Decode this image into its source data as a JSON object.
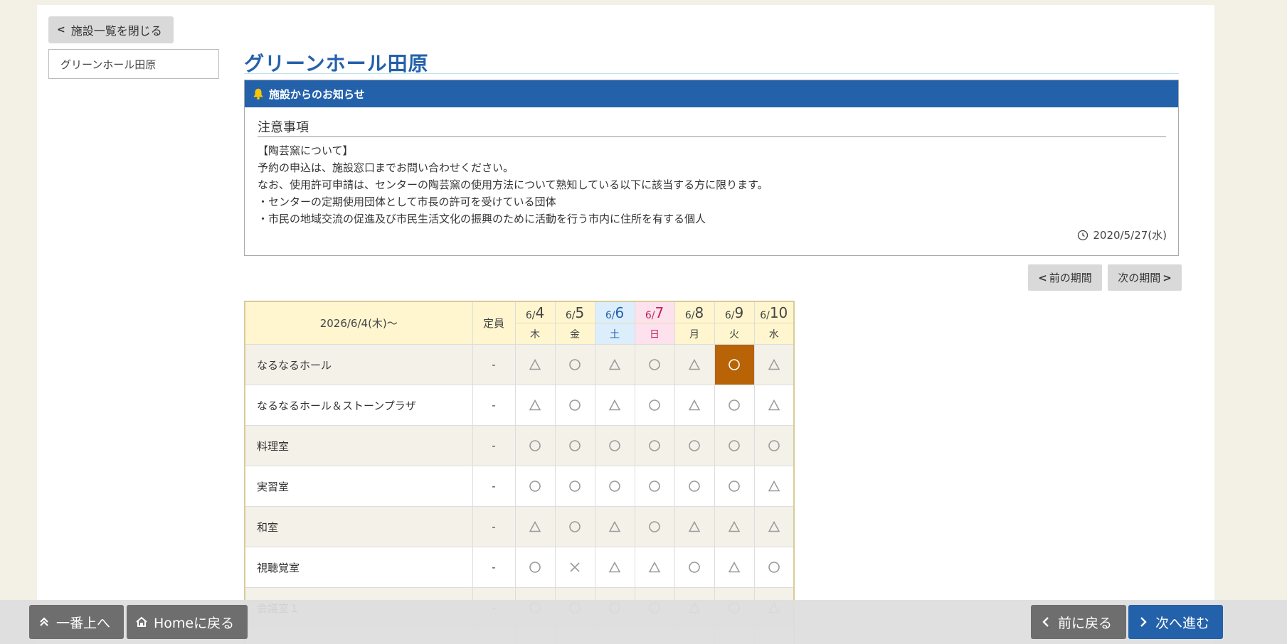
{
  "nav": {
    "close_list": "施設一覧を閉じる",
    "facility_item": "グリーンホール田原"
  },
  "facility": {
    "title": "グリーンホール田原"
  },
  "notice": {
    "header": "施設からのお知らせ",
    "subtitle": "注意事項",
    "lines": [
      "【陶芸窯について】",
      "予約の申込は、施設窓口までお問い合わせください。",
      "なお、使用許可申請は、センターの陶芸窯の使用方法について熟知している以下に該当する方に限ります。",
      "・センターの定期使用団体として市長の許可を受けている団体",
      "・市民の地域交流の促進及び市民生活文化の振興のために活動を行う市内に住所を有する個人"
    ],
    "date": "2020/5/27(水)"
  },
  "period": {
    "prev": "前の期間",
    "next": "次の期間"
  },
  "table": {
    "range_label": "2026/6/4(木)～",
    "capacity_label": "定員",
    "days": [
      {
        "m": "6/",
        "d": "4",
        "w": "木",
        "type": "weekday"
      },
      {
        "m": "6/",
        "d": "5",
        "w": "金",
        "type": "weekday"
      },
      {
        "m": "6/",
        "d": "6",
        "w": "土",
        "type": "sat"
      },
      {
        "m": "6/",
        "d": "7",
        "w": "日",
        "type": "sun"
      },
      {
        "m": "6/",
        "d": "8",
        "w": "月",
        "type": "weekday"
      },
      {
        "m": "6/",
        "d": "9",
        "w": "火",
        "type": "weekday"
      },
      {
        "m": "6/",
        "d": "10",
        "w": "水",
        "type": "weekday"
      }
    ],
    "rows": [
      {
        "name": "なるなるホール",
        "cap": "-",
        "cells": [
          "tri",
          "circle",
          "tri",
          "circle",
          "tri",
          "circle",
          "tri"
        ],
        "selected": 5
      },
      {
        "name": "なるなるホール＆ストーンプラザ",
        "cap": "-",
        "cells": [
          "tri",
          "circle",
          "tri",
          "circle",
          "tri",
          "circle",
          "tri"
        ]
      },
      {
        "name": "料理室",
        "cap": "-",
        "cells": [
          "circle",
          "circle",
          "circle",
          "circle",
          "circle",
          "circle",
          "circle"
        ]
      },
      {
        "name": "実習室",
        "cap": "-",
        "cells": [
          "circle",
          "circle",
          "circle",
          "circle",
          "circle",
          "circle",
          "tri"
        ]
      },
      {
        "name": "和室",
        "cap": "-",
        "cells": [
          "tri",
          "circle",
          "tri",
          "circle",
          "tri",
          "tri",
          "tri"
        ]
      },
      {
        "name": "視聴覚室",
        "cap": "-",
        "cells": [
          "circle",
          "cross",
          "tri",
          "tri",
          "circle",
          "tri",
          "circle"
        ]
      },
      {
        "name": "会議室１",
        "cap": "-",
        "cells": [
          "circle",
          "circle",
          "circle",
          "circle",
          "tri",
          "circle",
          "tri"
        ]
      },
      {
        "name": "",
        "cap": "",
        "cells": [
          "",
          "",
          "",
          "",
          "",
          "",
          ""
        ]
      }
    ]
  },
  "footer": {
    "to_top": "一番上へ",
    "home": "Homeに戻る",
    "back": "前に戻る",
    "forward": "次へ進む"
  },
  "colors": {
    "brand_blue": "#2461ab",
    "selected_cell": "#b86306",
    "header_bg": "#fff6d0"
  }
}
